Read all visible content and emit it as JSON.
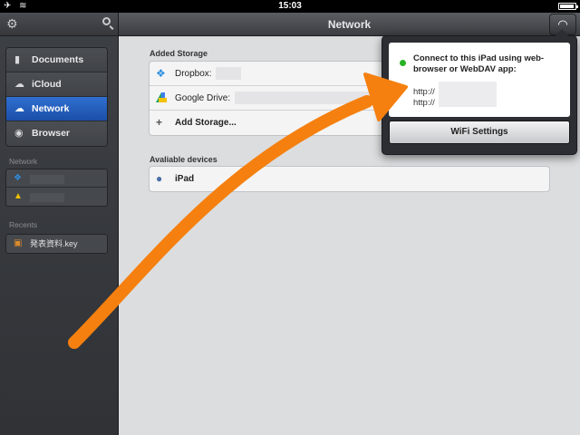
{
  "status_bar": {
    "time": "15:03",
    "icons": "✈ ≋"
  },
  "sidebar": {
    "nav_items": [
      {
        "label": "Documents",
        "icon": "document-icon"
      },
      {
        "label": "iCloud",
        "icon": "cloud-icon"
      },
      {
        "label": "Network",
        "icon": "network-cloud-icon",
        "active": true
      },
      {
        "label": "Browser",
        "icon": "compass-icon"
      }
    ],
    "network_section_label": "Network",
    "recents_section_label": "Recents",
    "recent_file": "発表資料.key"
  },
  "main": {
    "title": "Network",
    "added_storage_label": "Added Storage",
    "storage": {
      "dropbox": "Dropbox:",
      "gdrive": "Google Drive:",
      "add": "Add Storage..."
    },
    "devices_label": "Avaliable devices",
    "device_ipad": "iPad"
  },
  "popover": {
    "title": "Connect to this iPad using web-browser or WebDAV app:",
    "url1": "http://",
    "url2": "http://",
    "button": "WiFi Settings"
  },
  "colors": {
    "accent_arrow": "#f5800f",
    "active_nav": "#1f5cbf",
    "status_green": "#27b327"
  }
}
